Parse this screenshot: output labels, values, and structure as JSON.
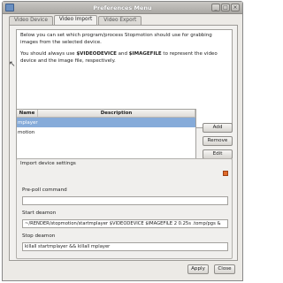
{
  "window": {
    "title": "Preferences Menu",
    "buttons": [
      "_",
      "□",
      "×"
    ]
  },
  "tabs": [
    {
      "label": "Video Device",
      "active": false
    },
    {
      "label": "Video Import",
      "active": true
    },
    {
      "label": "Video Export",
      "active": false
    }
  ],
  "info": {
    "paragraph1": "Below you can set which program/process Stopmotion should use for grabbing images from the selected device.",
    "paragraph2_pre": "You should always use ",
    "var1": "$VIDEODEVICE",
    "paragraph2_mid": " and ",
    "var2": "$IMAGEFILE",
    "paragraph2_post": " to represent the video device and the image file, respectively."
  },
  "grid": {
    "columns": [
      "Name",
      "Description"
    ],
    "rows": [
      {
        "name": "mplayer",
        "description": "",
        "selected": true
      },
      {
        "name": "motion",
        "description": "",
        "selected": false
      }
    ]
  },
  "side_buttons": {
    "add": "Add",
    "remove": "Remove",
    "edit": "Edit"
  },
  "settings": {
    "group_title": "Import device settings",
    "prepoll_label": "Pre-poll command",
    "prepoll_value": "",
    "start_label": "Start deamon",
    "start_value": "~/RENDER/stopmotion/startmplayer $VIDEODEVICE $IMAGEFILE 2 0.25s .tomp/pgs &",
    "stop_label": "Stop deamon",
    "stop_value": "killall startmplayer && killall mplayer"
  },
  "bottom_buttons": {
    "apply": "Apply",
    "close": "Close"
  },
  "colors": {
    "selection": "#86abd9",
    "titlebar": "#b5b3af",
    "warning_icon": "#e06a2a"
  }
}
